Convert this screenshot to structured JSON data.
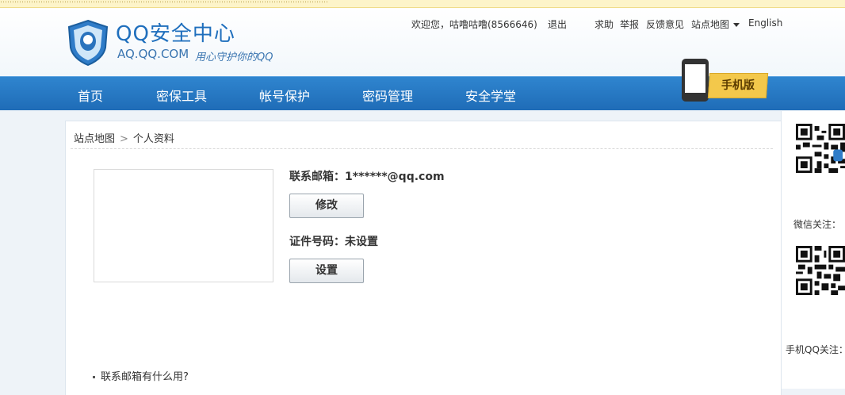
{
  "header": {
    "logo_title": "QQ安全中心",
    "logo_domain": "AQ.QQ.COM",
    "logo_slogan": "用心守护你的QQ",
    "welcome": "欢迎您，咕噜咕噜(8566646)",
    "logout": "退出",
    "links": {
      "help": "求助",
      "report": "举报",
      "feedback": "反馈意见",
      "sitemap": "站点地图",
      "english": "English"
    }
  },
  "nav": {
    "items": [
      "首页",
      "密保工具",
      "帐号保护",
      "密码管理",
      "安全学堂"
    ],
    "mobile_label": "手机版"
  },
  "breadcrumb": {
    "root": "站点地图",
    "separator": ">",
    "current": "个人资料"
  },
  "profile": {
    "email_label": "联系邮箱：",
    "email_value": "1******@qq.com",
    "modify_button": "修改",
    "id_label": "证件号码：",
    "id_value": "未设置",
    "set_button": "设置"
  },
  "faq": {
    "item1": "联系邮箱有什么用?"
  },
  "sidebar": {
    "wechat_caption": "微信关注：",
    "mobileqq_caption": "手机QQ关注："
  },
  "colors": {
    "brand_blue": "#1f6fbd",
    "nav_blue": "#2478c3",
    "mobile_tag": "#f3c84b"
  }
}
